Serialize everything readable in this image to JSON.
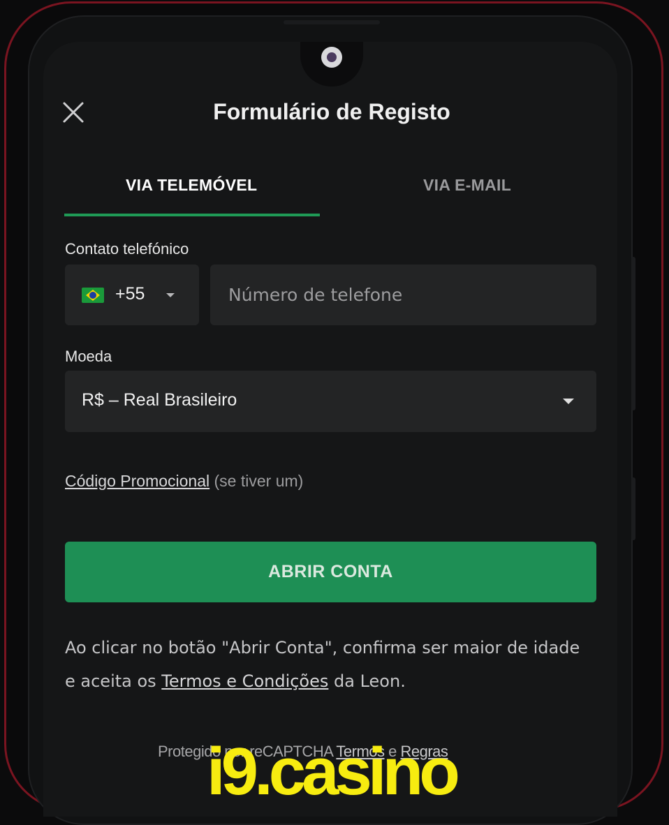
{
  "header": {
    "title": "Formulário de Registo",
    "close_icon": "close-icon"
  },
  "tabs": [
    {
      "label": "VIA TELEMÓVEL",
      "active": true
    },
    {
      "label": "VIA E-MAIL",
      "active": false
    }
  ],
  "phone": {
    "label": "Contato telefónico",
    "country_code": "+55",
    "country_flag": "brazil-flag-icon",
    "placeholder": "Número de telefone"
  },
  "currency": {
    "label": "Moeda",
    "selected": "R$ – Real Brasileiro"
  },
  "promo": {
    "link": "Código Promocional",
    "suffix": " (se tiver um)"
  },
  "submit": {
    "label": "ABRIR CONTA"
  },
  "terms": {
    "before": "Ao clicar no botão \"Abrir Conta\", confirma ser maior de idade e aceita os ",
    "link": "Termos e Condições",
    "after": " da Leon."
  },
  "recaptcha": {
    "prefix": "Protegido por reCAPTCHA ",
    "terms": "Termos",
    "and": " e ",
    "rules": "Regras"
  },
  "watermark": "i9.casino",
  "colors": {
    "accent": "#1f9a56",
    "button": "#1e8f55",
    "watermark": "#f7ec10",
    "frame": "#7a1420"
  }
}
